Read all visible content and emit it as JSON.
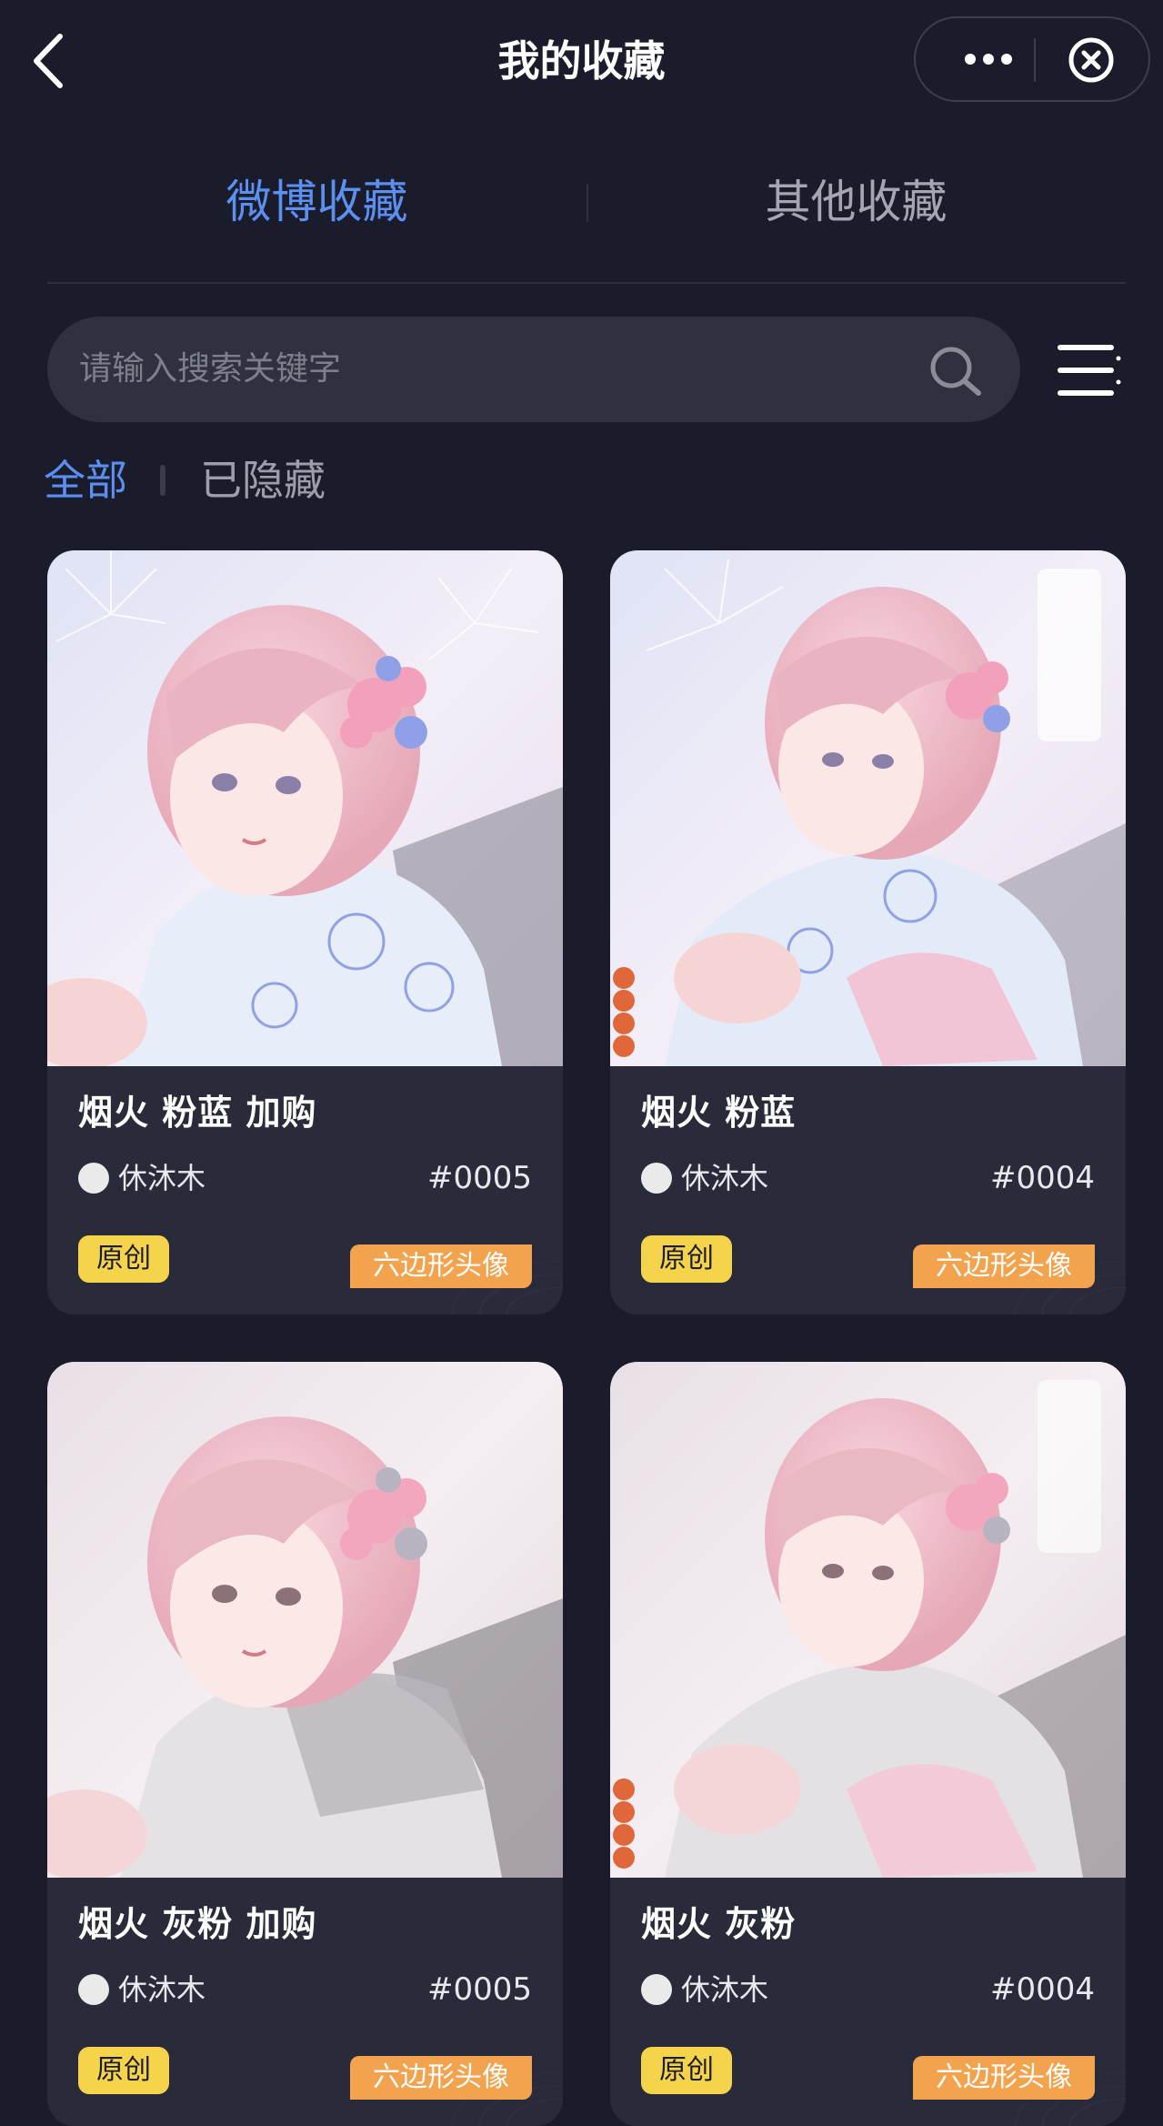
{
  "header": {
    "title": "我的收藏",
    "back_icon": "chevron-left-icon",
    "more_icon": "more-dots-icon",
    "close_icon": "close-circle-icon"
  },
  "tabs": [
    {
      "label": "微博收藏",
      "active": true
    },
    {
      "label": "其他收藏",
      "active": false
    }
  ],
  "search": {
    "placeholder": "请输入搜索关键字",
    "icon": "search-icon"
  },
  "menu_icon": "list-menu-icon",
  "filters": [
    {
      "label": "全部",
      "active": true
    },
    {
      "label": "已隐藏",
      "active": false
    }
  ],
  "cards": [
    {
      "title": "烟火 粉蓝 加购",
      "author": "休沐木",
      "serial": "#0005",
      "badge": "原创",
      "tag": "六边形头像",
      "palette": "pink-blue"
    },
    {
      "title": "烟火 粉蓝",
      "author": "休沐木",
      "serial": "#0004",
      "badge": "原创",
      "tag": "六边形头像",
      "palette": "pink-blue"
    },
    {
      "title": "烟火 灰粉 加购",
      "author": "休沐木",
      "serial": "#0005",
      "badge": "原创",
      "tag": "六边形头像",
      "palette": "grey-pink"
    },
    {
      "title": "烟火 灰粉",
      "author": "休沐木",
      "serial": "#0004",
      "badge": "原创",
      "tag": "六边形头像",
      "palette": "grey-pink"
    }
  ],
  "colors": {
    "background": "#1b1c2b",
    "accent": "#5b8ff0",
    "card": "#2a2b3a",
    "badge_yellow": "#f5d34a",
    "tag_orange": "#f3a24d"
  }
}
